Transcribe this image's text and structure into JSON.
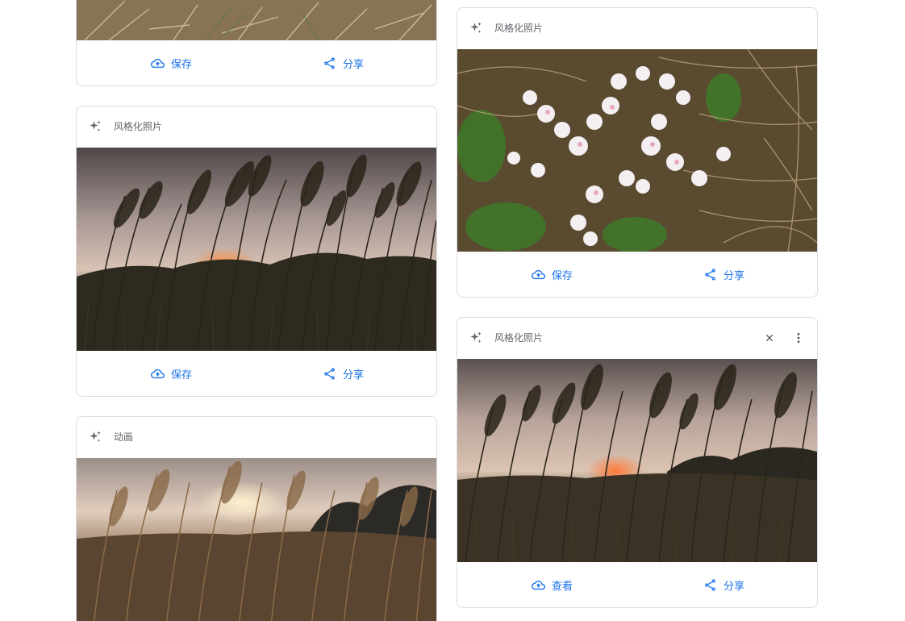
{
  "cards": [
    {
      "footer": {
        "primary": "保存",
        "secondary": "分享"
      }
    },
    {
      "header": {
        "title": "风格化照片"
      },
      "footer": {
        "primary": "保存",
        "secondary": "分享"
      }
    },
    {
      "header": {
        "title": "动画"
      }
    },
    {
      "header": {
        "title": "风格化照片"
      },
      "footer": {
        "primary": "保存",
        "secondary": "分享"
      }
    },
    {
      "header": {
        "title": "风格化照片"
      },
      "footer": {
        "primary": "查看",
        "secondary": "分享"
      }
    }
  ],
  "icons": {
    "header": "sparkle-icon",
    "save": "cloud-upload-icon",
    "share": "share-icon",
    "close": "close-icon",
    "menu": "more-vert-icon"
  },
  "colors": {
    "accent": "#1a73e8",
    "border": "#dadce0",
    "muted_text": "#5f6368"
  }
}
